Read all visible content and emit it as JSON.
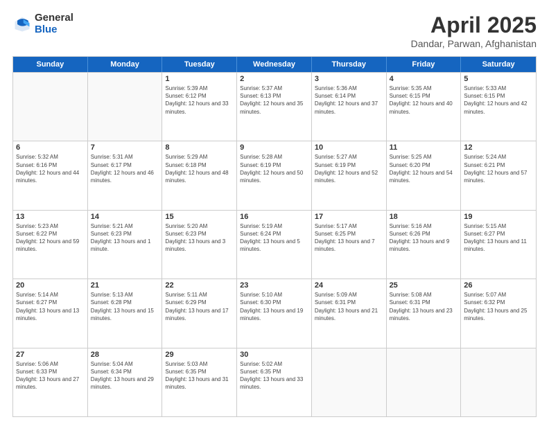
{
  "logo": {
    "general": "General",
    "blue": "Blue"
  },
  "title": "April 2025",
  "subtitle": "Dandar, Parwan, Afghanistan",
  "days": [
    "Sunday",
    "Monday",
    "Tuesday",
    "Wednesday",
    "Thursday",
    "Friday",
    "Saturday"
  ],
  "weeks": [
    [
      {
        "day": "",
        "empty": true
      },
      {
        "day": "",
        "empty": true
      },
      {
        "day": "1",
        "sunrise": "5:39 AM",
        "sunset": "6:12 PM",
        "daylight": "12 hours and 33 minutes."
      },
      {
        "day": "2",
        "sunrise": "5:37 AM",
        "sunset": "6:13 PM",
        "daylight": "12 hours and 35 minutes."
      },
      {
        "day": "3",
        "sunrise": "5:36 AM",
        "sunset": "6:14 PM",
        "daylight": "12 hours and 37 minutes."
      },
      {
        "day": "4",
        "sunrise": "5:35 AM",
        "sunset": "6:15 PM",
        "daylight": "12 hours and 40 minutes."
      },
      {
        "day": "5",
        "sunrise": "5:33 AM",
        "sunset": "6:15 PM",
        "daylight": "12 hours and 42 minutes."
      }
    ],
    [
      {
        "day": "6",
        "sunrise": "5:32 AM",
        "sunset": "6:16 PM",
        "daylight": "12 hours and 44 minutes."
      },
      {
        "day": "7",
        "sunrise": "5:31 AM",
        "sunset": "6:17 PM",
        "daylight": "12 hours and 46 minutes."
      },
      {
        "day": "8",
        "sunrise": "5:29 AM",
        "sunset": "6:18 PM",
        "daylight": "12 hours and 48 minutes."
      },
      {
        "day": "9",
        "sunrise": "5:28 AM",
        "sunset": "6:19 PM",
        "daylight": "12 hours and 50 minutes."
      },
      {
        "day": "10",
        "sunrise": "5:27 AM",
        "sunset": "6:19 PM",
        "daylight": "12 hours and 52 minutes."
      },
      {
        "day": "11",
        "sunrise": "5:25 AM",
        "sunset": "6:20 PM",
        "daylight": "12 hours and 54 minutes."
      },
      {
        "day": "12",
        "sunrise": "5:24 AM",
        "sunset": "6:21 PM",
        "daylight": "12 hours and 57 minutes."
      }
    ],
    [
      {
        "day": "13",
        "sunrise": "5:23 AM",
        "sunset": "6:22 PM",
        "daylight": "12 hours and 59 minutes."
      },
      {
        "day": "14",
        "sunrise": "5:21 AM",
        "sunset": "6:23 PM",
        "daylight": "13 hours and 1 minute."
      },
      {
        "day": "15",
        "sunrise": "5:20 AM",
        "sunset": "6:23 PM",
        "daylight": "13 hours and 3 minutes."
      },
      {
        "day": "16",
        "sunrise": "5:19 AM",
        "sunset": "6:24 PM",
        "daylight": "13 hours and 5 minutes."
      },
      {
        "day": "17",
        "sunrise": "5:17 AM",
        "sunset": "6:25 PM",
        "daylight": "13 hours and 7 minutes."
      },
      {
        "day": "18",
        "sunrise": "5:16 AM",
        "sunset": "6:26 PM",
        "daylight": "13 hours and 9 minutes."
      },
      {
        "day": "19",
        "sunrise": "5:15 AM",
        "sunset": "6:27 PM",
        "daylight": "13 hours and 11 minutes."
      }
    ],
    [
      {
        "day": "20",
        "sunrise": "5:14 AM",
        "sunset": "6:27 PM",
        "daylight": "13 hours and 13 minutes."
      },
      {
        "day": "21",
        "sunrise": "5:13 AM",
        "sunset": "6:28 PM",
        "daylight": "13 hours and 15 minutes."
      },
      {
        "day": "22",
        "sunrise": "5:11 AM",
        "sunset": "6:29 PM",
        "daylight": "13 hours and 17 minutes."
      },
      {
        "day": "23",
        "sunrise": "5:10 AM",
        "sunset": "6:30 PM",
        "daylight": "13 hours and 19 minutes."
      },
      {
        "day": "24",
        "sunrise": "5:09 AM",
        "sunset": "6:31 PM",
        "daylight": "13 hours and 21 minutes."
      },
      {
        "day": "25",
        "sunrise": "5:08 AM",
        "sunset": "6:31 PM",
        "daylight": "13 hours and 23 minutes."
      },
      {
        "day": "26",
        "sunrise": "5:07 AM",
        "sunset": "6:32 PM",
        "daylight": "13 hours and 25 minutes."
      }
    ],
    [
      {
        "day": "27",
        "sunrise": "5:06 AM",
        "sunset": "6:33 PM",
        "daylight": "13 hours and 27 minutes."
      },
      {
        "day": "28",
        "sunrise": "5:04 AM",
        "sunset": "6:34 PM",
        "daylight": "13 hours and 29 minutes."
      },
      {
        "day": "29",
        "sunrise": "5:03 AM",
        "sunset": "6:35 PM",
        "daylight": "13 hours and 31 minutes."
      },
      {
        "day": "30",
        "sunrise": "5:02 AM",
        "sunset": "6:35 PM",
        "daylight": "13 hours and 33 minutes."
      },
      {
        "day": "",
        "empty": true
      },
      {
        "day": "",
        "empty": true
      },
      {
        "day": "",
        "empty": true
      }
    ]
  ]
}
